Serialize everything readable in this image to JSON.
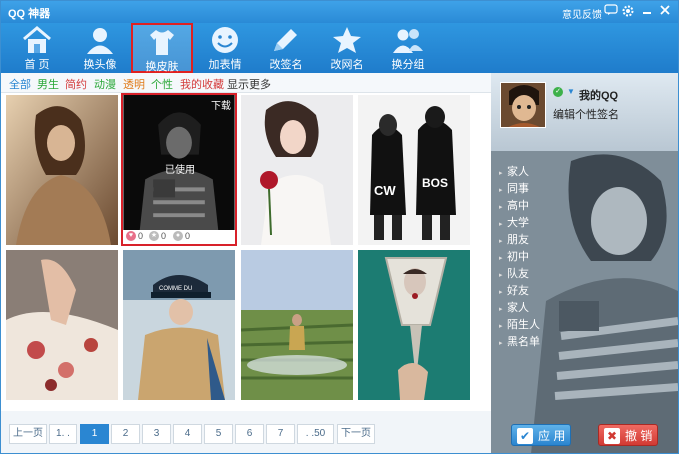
{
  "app": {
    "title": "QQ 神器",
    "feedback": "意见反馈"
  },
  "toolbar": {
    "items": [
      {
        "label": "首 页"
      },
      {
        "label": "换头像"
      },
      {
        "label": "换皮肤"
      },
      {
        "label": "加表情"
      },
      {
        "label": "改签名"
      },
      {
        "label": "改网名"
      },
      {
        "label": "换分组"
      }
    ]
  },
  "categories": [
    {
      "label": "全部",
      "color": "#2a86d2"
    },
    {
      "label": "男生",
      "color": "#2aa838"
    },
    {
      "label": "简约",
      "color": "#d43c3c"
    },
    {
      "label": "动漫",
      "color": "#2aa838"
    },
    {
      "label": "透明",
      "color": "#e07a1a"
    },
    {
      "label": "个性",
      "color": "#2aa838"
    },
    {
      "label": "我的收藏",
      "color": "#d43c3c"
    },
    {
      "label": "显示更多",
      "color": "#333333"
    }
  ],
  "gallery": {
    "download_label": "下载",
    "used_label": "已使用",
    "selected_stats": {
      "likes": "0",
      "favorites": "0",
      "views": "0"
    }
  },
  "pagination": {
    "prev": "上一页",
    "first": "1. .",
    "pages": [
      "1",
      "2",
      "3",
      "4",
      "5",
      "6",
      "7"
    ],
    "last": ". .50",
    "next": "下一页",
    "current": "1"
  },
  "profile": {
    "nickname": "我的QQ",
    "signature": "编辑个性签名"
  },
  "groups": [
    "家人",
    "同事",
    "高中",
    "大学",
    "朋友",
    "初中",
    "队友",
    "好友",
    "家人",
    "陌生人",
    "黑名单"
  ],
  "buttons": {
    "apply": "应 用",
    "cancel": "撤 销"
  }
}
